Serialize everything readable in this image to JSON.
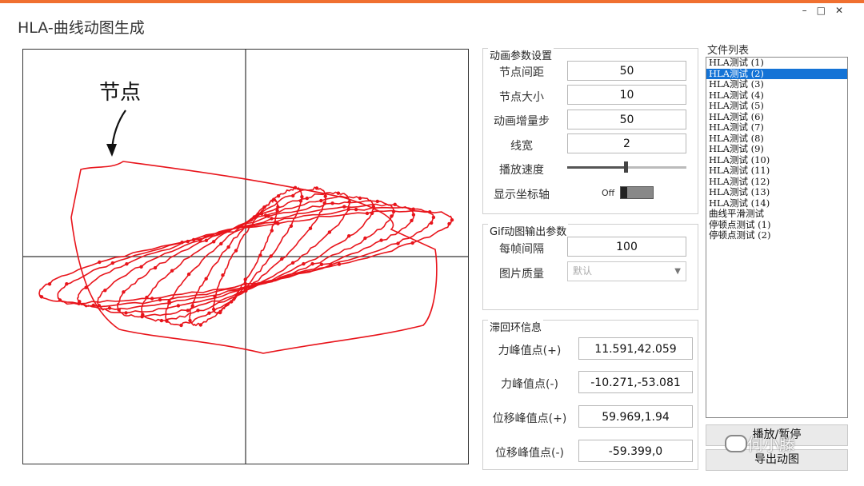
{
  "window": {
    "title": "HLA-曲线动图生成",
    "controls": [
      "minimize-icon",
      "maximize-icon",
      "close-icon"
    ],
    "accent": "#f07030"
  },
  "plot": {
    "annotation": "节点",
    "curve_color": "#e8141b",
    "axes_color": "#333333"
  },
  "anim_params": {
    "title": "动画参数设置",
    "node_spacing_label": "节点间距",
    "node_spacing_value": "50",
    "node_size_label": "节点大小",
    "node_size_value": "10",
    "anim_step_label": "动画增量步",
    "anim_step_value": "50",
    "line_width_label": "线宽",
    "line_width_value": "2",
    "play_speed_label": "播放速度",
    "play_speed_level": 0.49,
    "show_axes_label": "显示坐标轴",
    "show_axes_state": "Off"
  },
  "gif_params": {
    "title": "Gif动图输出参数",
    "frame_interval_label": "每帧间隔",
    "frame_interval_value": "100",
    "image_quality_label": "图片质量",
    "image_quality_value": "默认"
  },
  "hysteresis": {
    "title": "滞回环信息",
    "force_peak_pos_label": "力峰值点(+)",
    "force_peak_pos_value": "11.591,42.059",
    "force_peak_neg_label": "力峰值点(-)",
    "force_peak_neg_value": "-10.271,-53.081",
    "disp_peak_pos_label": "位移峰值点(+)",
    "disp_peak_pos_value": "59.969,1.94",
    "disp_peak_neg_label": "位移峰值点(-)",
    "disp_peak_neg_value": "-59.399,0"
  },
  "file_list": {
    "title": "文件列表",
    "items": [
      "HLA测试 (1)",
      "HLA测试 (2)",
      "HLA测试 (3)",
      "HLA测试 (4)",
      "HLA测试 (5)",
      "HLA测试 (6)",
      "HLA测试 (7)",
      "HLA测试 (8)",
      "HLA测试 (9)",
      "HLA测试 (10)",
      "HLA测试 (11)",
      "HLA测试 (12)",
      "HLA测试 (13)",
      "HLA测试 (14)",
      "曲线平滑测试",
      "停顿点测试 (1)",
      "停顿点测试 (2)"
    ],
    "selected_index": 1,
    "selected_color": "#1473d6"
  },
  "buttons": {
    "play_pause": "播放/暂停",
    "export": "导出动图"
  },
  "watermark": "何小滕"
}
